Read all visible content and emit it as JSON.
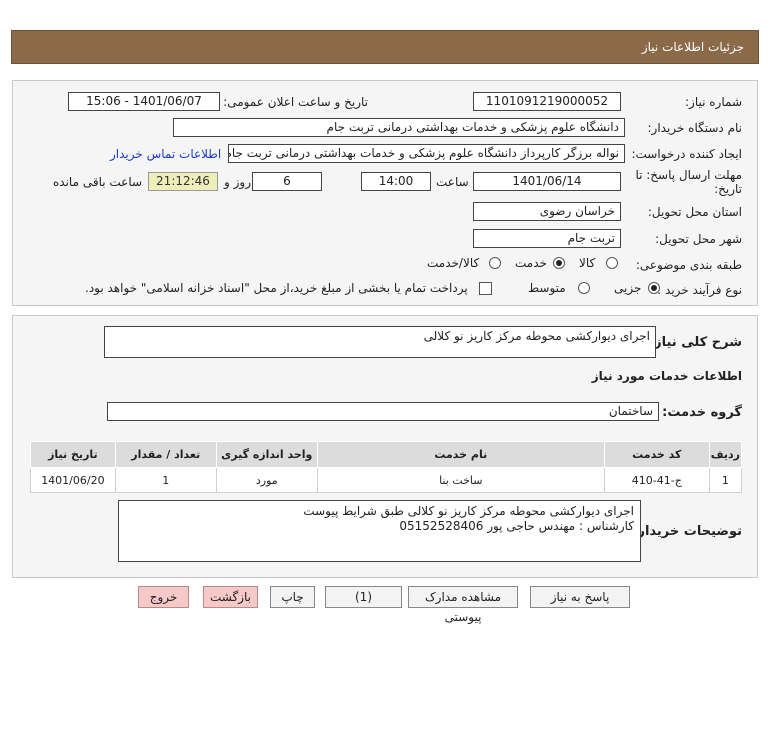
{
  "header": {
    "title": "جزئیات اطلاعات نیاز"
  },
  "details": {
    "need_number_label": "شماره نیاز:",
    "need_number": "1101091219000052",
    "announce_label": "تاریخ و ساعت اعلان عمومی:",
    "announce_value": "1401/06/07 - 15:06",
    "buyer_label": "نام دستگاه خریدار:",
    "buyer_value": "دانشگاه علوم پزشکی و خدمات بهداشتی  درمانی تربت جام",
    "creator_label": "ایجاد کننده درخواست:",
    "creator_value": "نواله برزگر کارپرداز دانشگاه علوم پزشکی و خدمات بهداشتی  درمانی تربت جام",
    "contact_link": "اطلاعات تماس خریدار",
    "deadline_label_1": "مهلت ارسال پاسخ: تا",
    "deadline_label_2": "تاریخ:",
    "deadline_date": "1401/06/14",
    "time_label": "ساعت",
    "deadline_time": "14:00",
    "days_value": "6",
    "days_label": "روز و",
    "remaining_value": "21:12:46",
    "remaining_label": "ساعت باقی مانده",
    "province_label": "استان محل تحویل:",
    "province_value": "خراسان رضوی",
    "city_label": "شهر محل تحویل:",
    "city_value": "تربت جام",
    "category_label": "طبقه بندی موضوعی:",
    "category_options": [
      "کالا",
      "خدمت",
      "کالا/خدمت"
    ],
    "category_selected": 1,
    "process_label": "نوع فرآیند خرید :",
    "process_options": [
      "جزیی",
      "متوسط"
    ],
    "process_selected": 0,
    "payment_text": "پرداخت تمام یا بخشی از مبلغ خرید،از محل \"اسناد خزانه اسلامی\" خواهد بود."
  },
  "summary": {
    "general_label": "شرح کلی نیاز:",
    "general_value": "اجرای دیوارکشی محوطه مرکز کاریز نو کلالی",
    "services_title": "اطلاعات خدمات مورد نیاز",
    "group_label": "گروه خدمت:",
    "group_value": "ساختمان",
    "columns": [
      "ردیف",
      "کد خدمت",
      "نام خدمت",
      "واحد اندازه گیری",
      "تعداد / مقدار",
      "تاریخ نیاز"
    ],
    "rows": [
      [
        "1",
        "ج-41-410",
        "ساخت بنا",
        "مورد",
        "1",
        "1401/06/20"
      ]
    ],
    "buyer_notes_label": "توضیحات خریدار:",
    "buyer_notes": "اجرای دیوارکشی محوطه مرکز کاریز نو کلالی طبق شرایط پیوست\nکارشناس : مهندس حاجی پور 05152528406"
  },
  "buttons": {
    "reply": "پاسخ به نیاز",
    "view_docs": "مشاهده مدارک پیوستی (1)",
    "print": "چاپ",
    "back": "بازگشت",
    "exit": "خروج"
  },
  "colors": {
    "header_bg": "#8b6a4a",
    "link": "#1a3cc8",
    "remaining_bg": "#eeeebb",
    "danger_btn": "#f6c9c9"
  }
}
